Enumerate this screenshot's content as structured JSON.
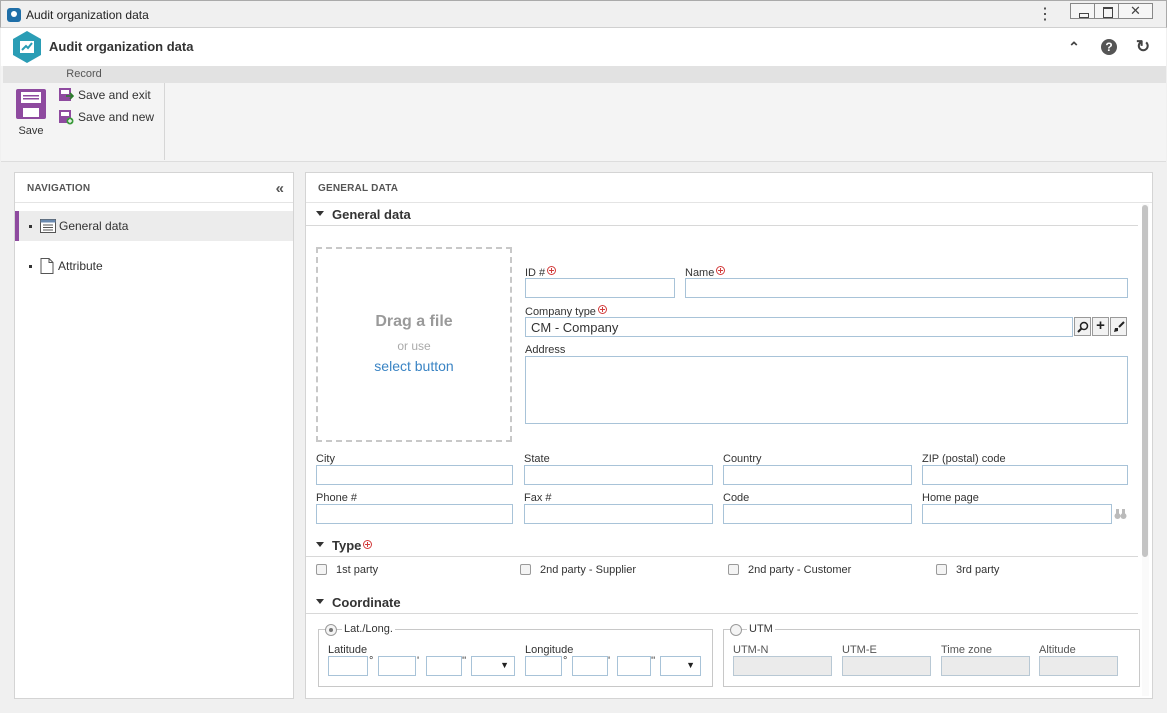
{
  "window": {
    "title": "Audit organization data",
    "menu_glyph": "⋮",
    "close_glyph": "✕"
  },
  "header": {
    "title": "Audit organization data",
    "collapse_glyph": "⌃",
    "help_glyph": "?",
    "refresh_glyph": "↻"
  },
  "ribbon": {
    "group_label": "Record",
    "save_label": "Save",
    "save_exit_label": "Save and exit",
    "save_new_label": "Save and new"
  },
  "navigation": {
    "title": "NAVIGATION",
    "collapse_glyph": "«",
    "items": [
      {
        "label": "General data",
        "icon": "list-icon",
        "active": true
      },
      {
        "label": "Attribute",
        "icon": "document-icon",
        "active": false
      }
    ]
  },
  "main": {
    "title": "GENERAL DATA",
    "sections": {
      "general": "General data",
      "type": "Type",
      "coordinate": "Coordinate"
    },
    "dropzone": {
      "title": "Drag a file",
      "or": "or use",
      "link": "select button"
    },
    "fields": {
      "id": {
        "label": "ID #",
        "value": ""
      },
      "name": {
        "label": "Name",
        "value": ""
      },
      "company_type": {
        "label": "Company type",
        "value": "CM - Company"
      },
      "address": {
        "label": "Address",
        "value": ""
      },
      "city": {
        "label": "City",
        "value": ""
      },
      "state": {
        "label": "State",
        "value": ""
      },
      "country": {
        "label": "Country",
        "value": ""
      },
      "zip": {
        "label": "ZIP (postal) code",
        "value": ""
      },
      "phone": {
        "label": "Phone #",
        "value": ""
      },
      "fax": {
        "label": "Fax #",
        "value": ""
      },
      "code": {
        "label": "Code",
        "value": ""
      },
      "home_page": {
        "label": "Home page",
        "value": ""
      }
    },
    "lookup_buttons": {
      "search": "🔍",
      "add": "+",
      "clear": "🖌"
    },
    "type_options": [
      {
        "label": "1st party",
        "checked": false
      },
      {
        "label": "2nd party - Supplier",
        "checked": false
      },
      {
        "label": "2nd party - Customer",
        "checked": false
      },
      {
        "label": "3rd party",
        "checked": false
      }
    ],
    "coordinate": {
      "latlong": {
        "label": "Lat./Long.",
        "selected": true,
        "latitude_label": "Latitude",
        "longitude_label": "Longitude",
        "degree": "°",
        "minute": "'",
        "second": "''"
      },
      "utm": {
        "label": "UTM",
        "selected": false,
        "fields": [
          "UTM-N",
          "UTM-E",
          "Time zone",
          "Altitude"
        ]
      }
    }
  },
  "colors": {
    "accent": "#8e4a9f",
    "brand": "#2a9db5",
    "link": "#3a84c4",
    "required": "#d23c3c"
  }
}
